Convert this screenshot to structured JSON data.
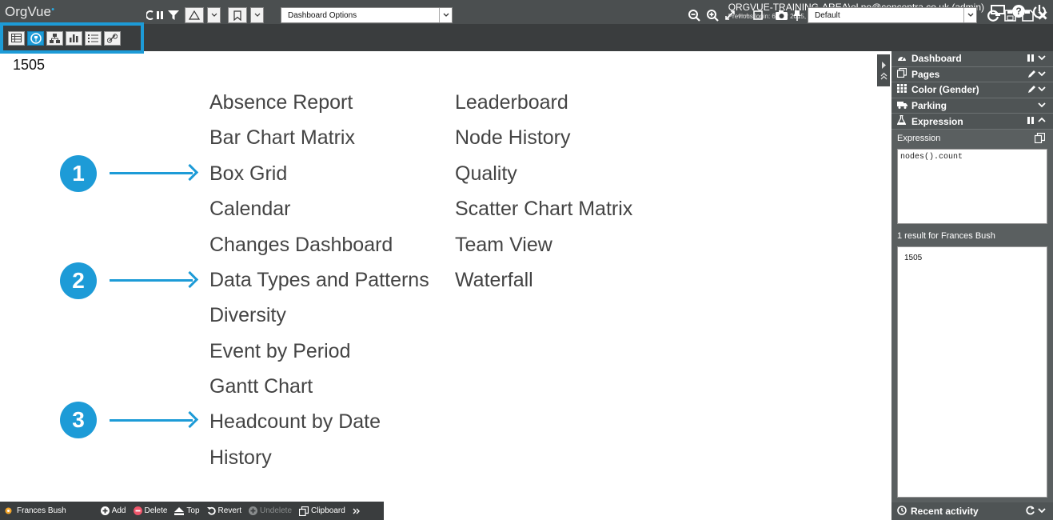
{
  "header": {
    "app_name": "OrgVue",
    "user": "ORGVUE-TRAINING-AREA\\el.no@concentra.co.uk (admin)",
    "previous_login": "Previous login: 6 Mar 2015, 14:28"
  },
  "toolbar": {
    "view_buttons": [
      "table-view",
      "tree-view",
      "org-chart-view",
      "bar-chart-view",
      "list-view",
      "link-view"
    ],
    "dashboard_options": "Dashboard Options",
    "default_select": "Default"
  },
  "count": "1505",
  "dashboards": {
    "col1": [
      "Absence Report",
      "Bar Chart Matrix",
      "Box Grid",
      "Calendar",
      "Changes Dashboard",
      "Data Types and Patterns",
      "Diversity",
      "Event by Period",
      "Gantt Chart",
      "Headcount by Date",
      "History"
    ],
    "col2": [
      "Leaderboard",
      "Node History",
      "Quality",
      "Scatter Chart Matrix",
      "Team View",
      "Waterfall"
    ]
  },
  "callouts": [
    "1",
    "2",
    "3"
  ],
  "panel": {
    "sections": [
      "Dashboard",
      "Pages",
      "Color (Gender)",
      "Parking",
      "Expression"
    ],
    "expression_label": "Expression",
    "expression_value": "nodes().count",
    "result_label": "1 result for Frances Bush",
    "result_value": "1505",
    "footer": "Recent activity"
  },
  "bottombar": {
    "node": "Frances Bush",
    "actions": [
      "Add",
      "Delete",
      "Top",
      "Revert",
      "Undelete",
      "Clipboard"
    ]
  },
  "colors": {
    "accent": "#1d9bd7",
    "header": "#4b4f50",
    "toolbar": "#3a3d3e"
  }
}
